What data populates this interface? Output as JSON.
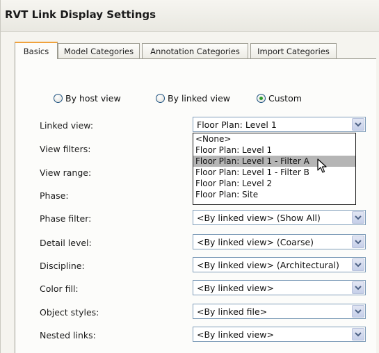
{
  "window": {
    "title": "RVT Link Display Settings"
  },
  "tabs": [
    {
      "label": "Basics",
      "active": true
    },
    {
      "label": "Model Categories",
      "active": false
    },
    {
      "label": "Annotation Categories",
      "active": false
    },
    {
      "label": "Import Categories",
      "active": false
    }
  ],
  "display_mode": {
    "options": [
      "By host view",
      "By linked view",
      "Custom"
    ],
    "selected": "Custom"
  },
  "fields": {
    "linked_view": {
      "label": "Linked view:",
      "value": "Floor Plan: Level 1"
    },
    "view_filters": {
      "label": "View filters:"
    },
    "view_range": {
      "label": "View range:"
    },
    "phase": {
      "label": "Phase:"
    },
    "phase_filter": {
      "label": "Phase filter:",
      "value": "<By linked view> (Show All)"
    },
    "detail_level": {
      "label": "Detail level:",
      "value": "<By linked view> (Coarse)"
    },
    "discipline": {
      "label": "Discipline:",
      "value": "<By linked view> (Architectural)"
    },
    "color_fill": {
      "label": "Color fill:",
      "value": "<By linked view>"
    },
    "object_styles": {
      "label": "Object styles:",
      "value": "<By linked file>"
    },
    "nested_links": {
      "label": "Nested links:",
      "value": "<By linked view>"
    }
  },
  "linked_view_dropdown": {
    "options": [
      "<None>",
      "Floor Plan: Level 1",
      "Floor Plan: Level 1 - Filter A",
      "Floor Plan: Level 1 - Filter B",
      "Floor Plan: Level 2",
      "Floor Plan: Site"
    ],
    "highlighted": "Floor Plan: Level 1 - Filter A"
  },
  "icons": {
    "dropdown_arrow": "chevron-down-icon",
    "cursor": "mouse-pointer-icon"
  },
  "colors": {
    "active_tab_accent": "#f0a23c",
    "radio_selected": "#2b9a2b",
    "combo_border": "#7f9db9",
    "highlight": "#b5b5b5"
  }
}
